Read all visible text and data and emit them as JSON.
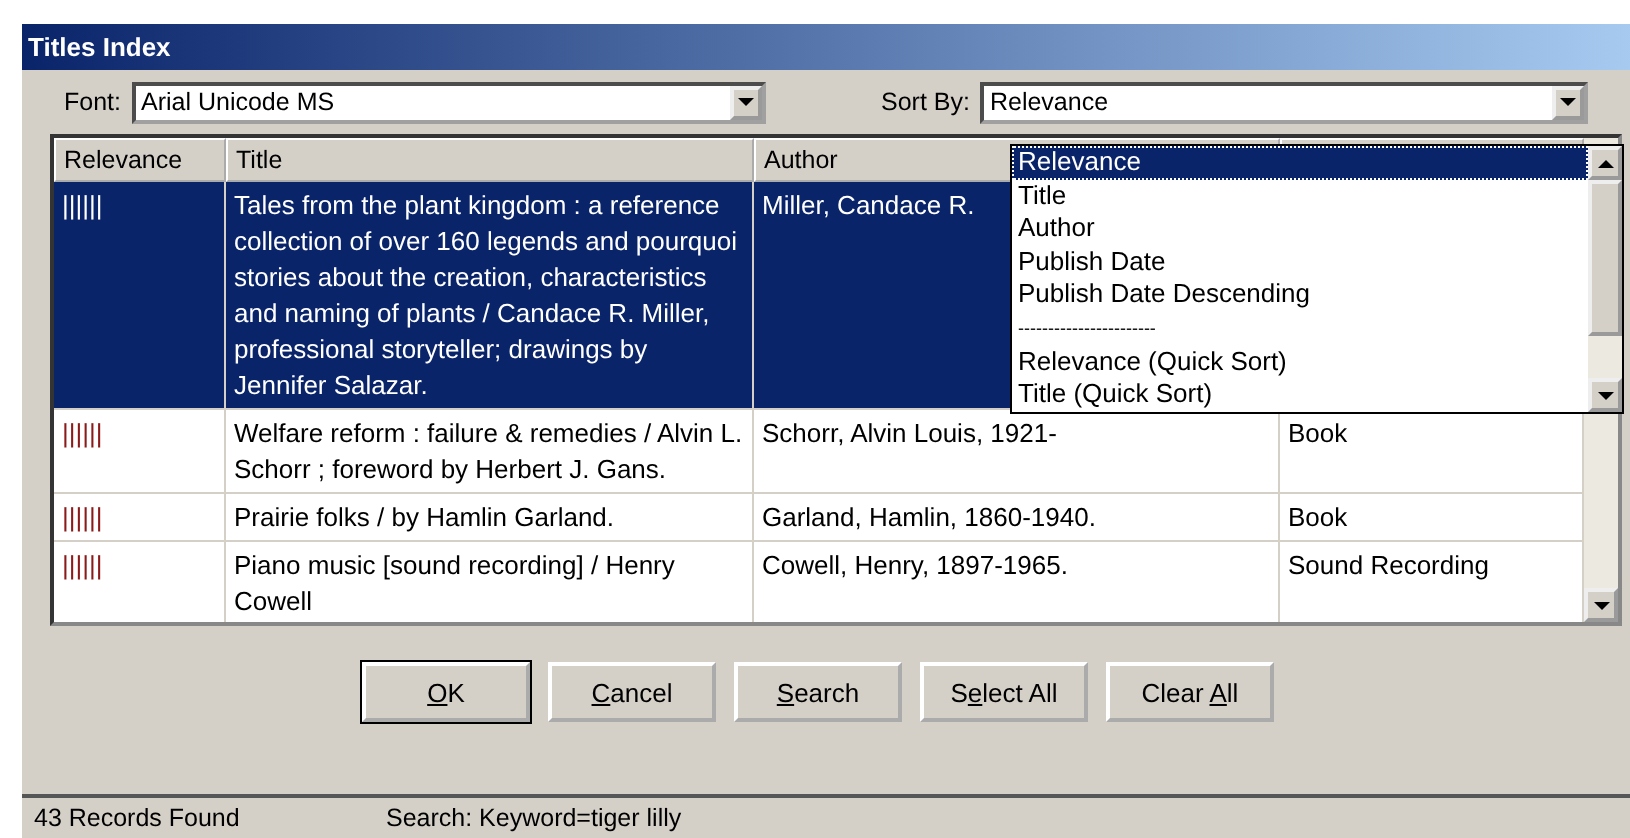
{
  "window": {
    "title": "Titles Index"
  },
  "font": {
    "label": "Font:",
    "value": "Arial Unicode MS"
  },
  "sort": {
    "label": "Sort By:",
    "value": "Relevance",
    "expanded": true,
    "options": [
      {
        "kind": "option",
        "label": "Relevance",
        "selected": true
      },
      {
        "kind": "option",
        "label": "Title",
        "selected": false
      },
      {
        "kind": "option",
        "label": "Author",
        "selected": false
      },
      {
        "kind": "option",
        "label": "Publish Date",
        "selected": false
      },
      {
        "kind": "option",
        "label": "Publish Date Descending",
        "selected": false
      },
      {
        "kind": "separator",
        "label": "-----------------------"
      },
      {
        "kind": "option",
        "label": "Relevance (Quick Sort)",
        "selected": false
      },
      {
        "kind": "option",
        "label": "Title (Quick Sort)",
        "selected": false
      }
    ]
  },
  "table": {
    "columns": [
      "Relevance",
      "Title",
      "Author"
    ],
    "rows": [
      {
        "selected": true,
        "relevance": "||||||",
        "title": "Tales from the plant kingdom : a reference collection of over 160 legends and pourquoi stories about the creation, characteristics and naming of plants / Candace R. Miller, professional storyteller; drawings by Jennifer Salazar.",
        "author": "Miller, Candace R."
      },
      {
        "selected": false,
        "relevance": "||||||",
        "title": "Welfare reform : failure & remedies / Alvin L. Schorr ; foreword by Herbert J. Gans.",
        "author": "Schorr, Alvin Louis, 1921-",
        "column_4": "Book"
      },
      {
        "selected": false,
        "relevance": "||||||",
        "title": "Prairie folks / by Hamlin Garland.",
        "author": "Garland, Hamlin, 1860-1940.",
        "column_4": "Book"
      },
      {
        "selected": false,
        "relevance": "||||||",
        "title": "Piano music [sound recording] / Henry Cowell",
        "author": "Cowell, Henry, 1897-1965.",
        "column_4": "Sound Recording"
      }
    ]
  },
  "buttons": [
    {
      "key": "O",
      "post": "K"
    },
    {
      "key": "C",
      "post": "ancel"
    },
    {
      "key": "S",
      "post": "earch"
    },
    {
      "pre": "S",
      "key": "e",
      "post": "lect All"
    },
    {
      "pre": "Clear ",
      "key": "A",
      "post": "ll"
    }
  ],
  "status_bar": {
    "count": "43 Records Found",
    "search": "Search: Keyword=tiger lilly"
  }
}
